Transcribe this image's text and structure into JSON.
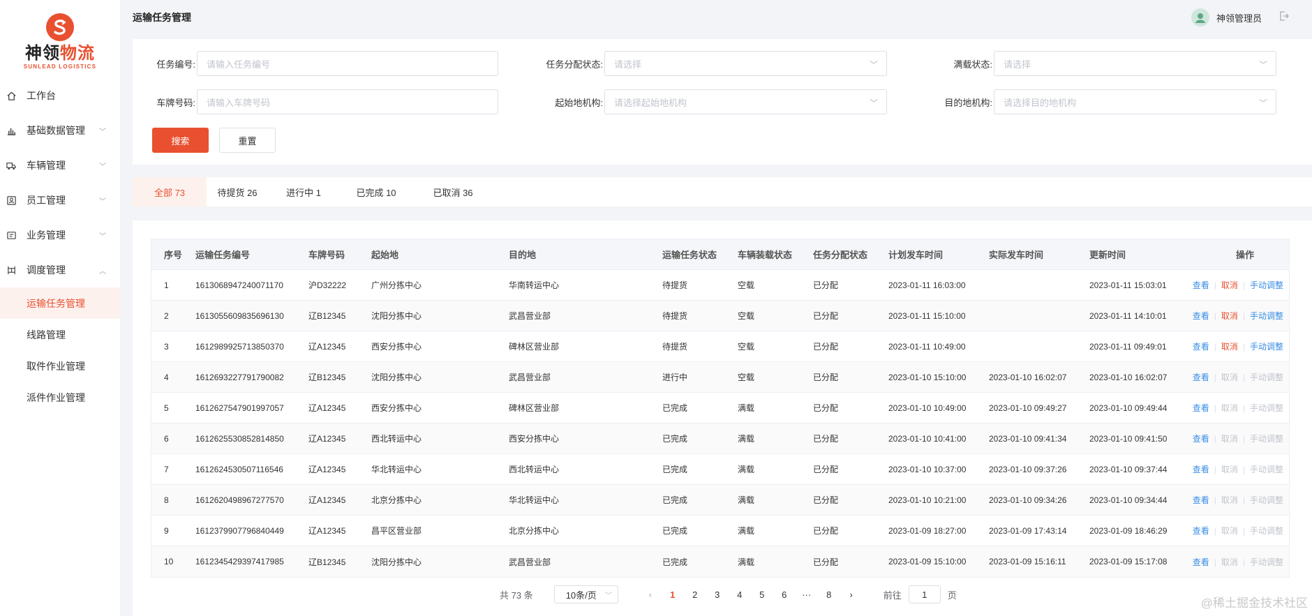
{
  "brand": {
    "name_cn_1": "神领",
    "name_cn_2": "物流",
    "name_en": "SUNLEAD LOGISTICS",
    "color": "#e8502f"
  },
  "header": {
    "title": "运输任务管理",
    "username": "神领管理员"
  },
  "sidebar": {
    "items": [
      {
        "label": "工作台",
        "icon": "home-icon",
        "has_arrow": false,
        "arrow": ""
      },
      {
        "label": "基础数据管理",
        "icon": "chart-icon",
        "has_arrow": true,
        "arrow": "﹀"
      },
      {
        "label": "车辆管理",
        "icon": "truck-icon",
        "has_arrow": true,
        "arrow": "﹀"
      },
      {
        "label": "员工管理",
        "icon": "id-card-icon",
        "has_arrow": true,
        "arrow": "﹀"
      },
      {
        "label": "业务管理",
        "icon": "wallet-icon",
        "has_arrow": true,
        "arrow": "﹀"
      },
      {
        "label": "调度管理",
        "icon": "dispatch-icon",
        "has_arrow": true,
        "arrow": "︿"
      }
    ],
    "subitems": [
      {
        "label": "运输任务管理",
        "active": true
      },
      {
        "label": "线路管理",
        "active": false
      },
      {
        "label": "取件作业管理",
        "active": false
      },
      {
        "label": "派件作业管理",
        "active": false
      }
    ]
  },
  "search": {
    "task_no": {
      "label": "任务编号:",
      "placeholder": "请输入任务编号"
    },
    "assign_status": {
      "label": "任务分配状态:",
      "placeholder": "请选择"
    },
    "load_status": {
      "label": "满载状态:",
      "placeholder": "请选择"
    },
    "plate": {
      "label": "车牌号码:",
      "placeholder": "请输入车牌号码"
    },
    "origin": {
      "label": "起始地机构:",
      "placeholder": "请选择起始地机构"
    },
    "dest": {
      "label": "目的地机构:",
      "placeholder": "请选择目的地机构"
    },
    "search_btn": "搜索",
    "reset_btn": "重置"
  },
  "tabs": [
    {
      "label": "全部 73",
      "active": true
    },
    {
      "label": "待提货 26",
      "active": false
    },
    {
      "label": "进行中 1",
      "active": false
    },
    {
      "label": "已完成 10",
      "active": false
    },
    {
      "label": "已取消 36",
      "active": false
    }
  ],
  "table": {
    "columns": [
      "序号",
      "运输任务编号",
      "车牌号码",
      "起始地",
      "目的地",
      "运输任务状态",
      "车辆装载状态",
      "任务分配状态",
      "计划发车时间",
      "实际发车时间",
      "更新时间",
      "操作"
    ],
    "actions": {
      "view": "查看",
      "cancel": "取消",
      "adjust": "手动调整"
    },
    "rows": [
      [
        "1",
        "1613068947240071170",
        "沪D32222",
        "广州分拣中心",
        "华南转运中心",
        "待提货",
        "空载",
        "已分配",
        "2023-01-11 16:03:00",
        "",
        "2023-01-11 15:03:01"
      ],
      [
        "2",
        "1613055609835696130",
        "辽B12345",
        "沈阳分拣中心",
        "武昌营业部",
        "待提货",
        "空载",
        "已分配",
        "2023-01-11 15:10:00",
        "",
        "2023-01-11 14:10:01"
      ],
      [
        "3",
        "1612989925713850370",
        "辽A12345",
        "西安分拣中心",
        "碑林区营业部",
        "待提货",
        "空载",
        "已分配",
        "2023-01-11 10:49:00",
        "",
        "2023-01-11 09:49:01"
      ],
      [
        "4",
        "1612693227791790082",
        "辽B12345",
        "沈阳分拣中心",
        "武昌营业部",
        "进行中",
        "空载",
        "已分配",
        "2023-01-10 15:10:00",
        "2023-01-10 16:02:07",
        "2023-01-10 16:02:07"
      ],
      [
        "5",
        "1612627547901997057",
        "辽A12345",
        "西安分拣中心",
        "碑林区营业部",
        "已完成",
        "满载",
        "已分配",
        "2023-01-10 10:49:00",
        "2023-01-10 09:49:27",
        "2023-01-10 09:49:44"
      ],
      [
        "6",
        "1612625530852814850",
        "辽A12345",
        "西北转运中心",
        "西安分拣中心",
        "已完成",
        "满载",
        "已分配",
        "2023-01-10 10:41:00",
        "2023-01-10 09:41:34",
        "2023-01-10 09:41:50"
      ],
      [
        "7",
        "1612624530507116546",
        "辽A12345",
        "华北转运中心",
        "西北转运中心",
        "已完成",
        "满载",
        "已分配",
        "2023-01-10 10:37:00",
        "2023-01-10 09:37:26",
        "2023-01-10 09:37:44"
      ],
      [
        "8",
        "1612620498967277570",
        "辽A12345",
        "北京分拣中心",
        "华北转运中心",
        "已完成",
        "满载",
        "已分配",
        "2023-01-10 10:21:00",
        "2023-01-10 09:34:26",
        "2023-01-10 09:34:44"
      ],
      [
        "9",
        "1612379907796840449",
        "辽A12345",
        "昌平区营业部",
        "北京分拣中心",
        "已完成",
        "满载",
        "已分配",
        "2023-01-09 18:27:00",
        "2023-01-09 17:43:14",
        "2023-01-09 18:46:29"
      ],
      [
        "10",
        "1612345429397417985",
        "辽B12345",
        "沈阳分拣中心",
        "武昌营业部",
        "已完成",
        "满载",
        "已分配",
        "2023-01-09 15:10:00",
        "2023-01-09 15:16:11",
        "2023-01-09 15:17:08"
      ]
    ],
    "actions_enabled": [
      true,
      true,
      true,
      false,
      false,
      false,
      false,
      false,
      false,
      false
    ]
  },
  "pagination": {
    "total": "共 73 条",
    "page_size": "10条/页",
    "pages": [
      "1",
      "2",
      "3",
      "4",
      "5",
      "6",
      "···",
      "8"
    ],
    "current": "1",
    "prev": "‹",
    "next": "›",
    "goto_label": "前往",
    "goto_value": "1",
    "goto_suffix": "页"
  },
  "watermark": "@稀土掘金技术社区",
  "colors": {
    "accent": "#e8502f",
    "link": "#3a8ee6",
    "disabled": "#c0c4cc"
  }
}
